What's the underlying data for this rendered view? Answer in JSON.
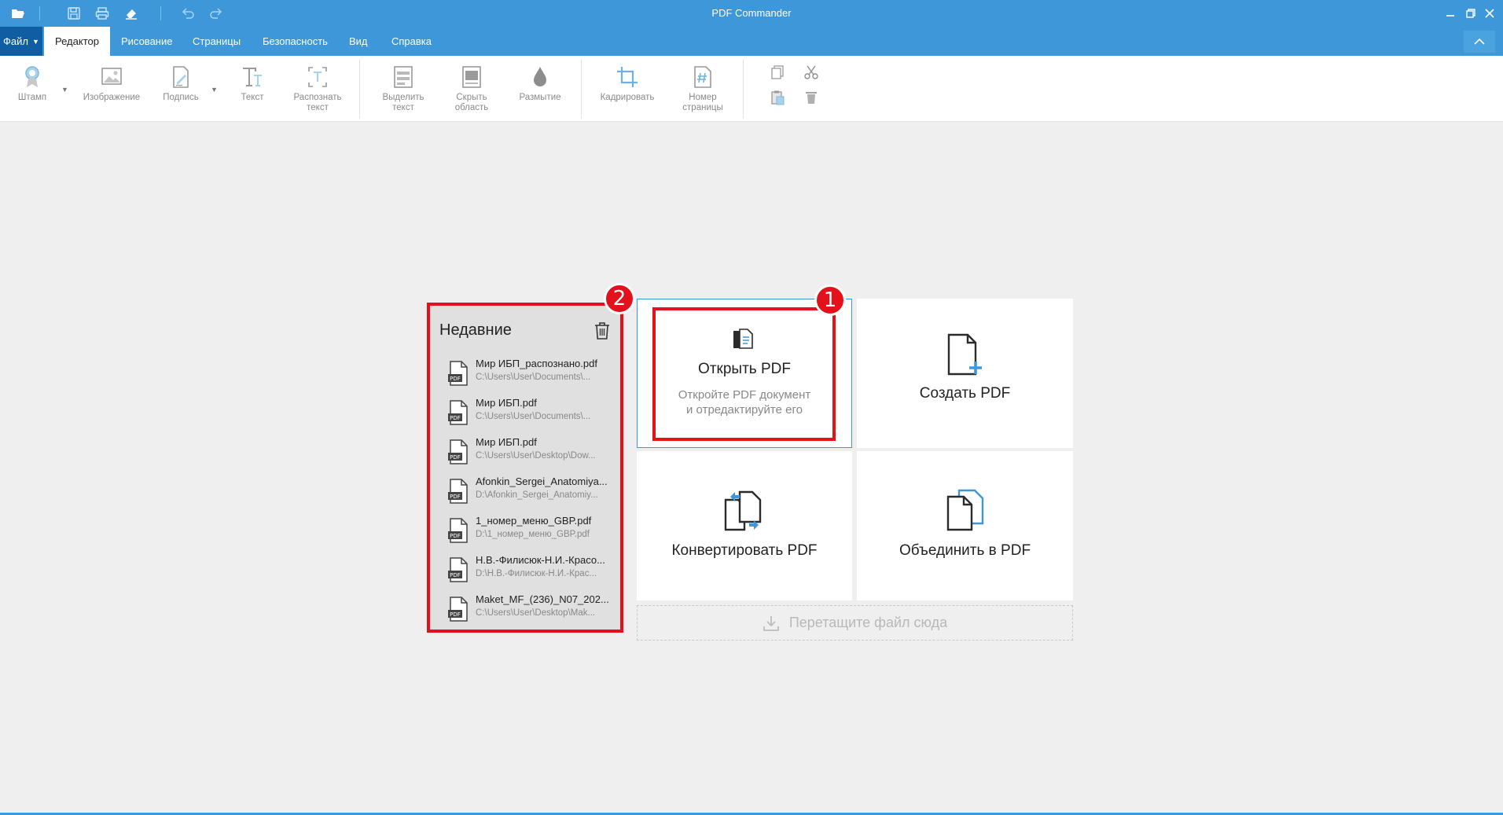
{
  "window": {
    "title": "PDF Commander"
  },
  "menu": {
    "file_label": "Файл",
    "tabs": [
      "Редактор",
      "Рисование",
      "Страницы",
      "Безопасность",
      "Вид",
      "Справка"
    ]
  },
  "ribbon": {
    "stamp": "Штамп",
    "image": "Изображение",
    "signature": "Подпись",
    "text": "Текст",
    "ocr": "Распознать\nтекст",
    "select_text": "Выделить\nтекст",
    "hide_area": "Скрыть\nобласть",
    "blur": "Размытие",
    "crop": "Кадрировать",
    "page_number": "Номер\nстраницы"
  },
  "recent": {
    "title": "Недавние",
    "items": [
      {
        "name": "Мир ИБП_распознано.pdf",
        "path": "C:\\Users\\User\\Documents\\..."
      },
      {
        "name": "Мир ИБП.pdf",
        "path": "C:\\Users\\User\\Documents\\..."
      },
      {
        "name": "Мир ИБП.pdf",
        "path": "C:\\Users\\User\\Desktop\\Dow..."
      },
      {
        "name": "Afonkin_Sergei_Anatomiya...",
        "path": "D:\\Afonkin_Sergei_Anatomiy..."
      },
      {
        "name": "1_номер_меню_GBP.pdf",
        "path": "D:\\1_номер_меню_GBP.pdf"
      },
      {
        "name": "Н.В.-Филисюк-Н.И.-Красо...",
        "path": "D:\\Н.В.-Филисюк-Н.И.-Крас..."
      },
      {
        "name": "Maket_MF_(236)_N07_202...",
        "path": "C:\\Users\\User\\Desktop\\Mak..."
      }
    ]
  },
  "cards": {
    "open_title": "Открыть PDF",
    "open_desc": "Откройте PDF документ\nи отредактируйте его",
    "create_title": "Создать PDF",
    "convert_title": "Конвертировать PDF",
    "merge_title": "Объединить в PDF"
  },
  "dropzone": {
    "label": "Перетащите файл сюда"
  },
  "annotations": {
    "badge1": "1",
    "badge2": "2"
  },
  "colors": {
    "accent": "#3d97d8",
    "file_button": "#0f5da3",
    "highlight": "#e3111b"
  }
}
